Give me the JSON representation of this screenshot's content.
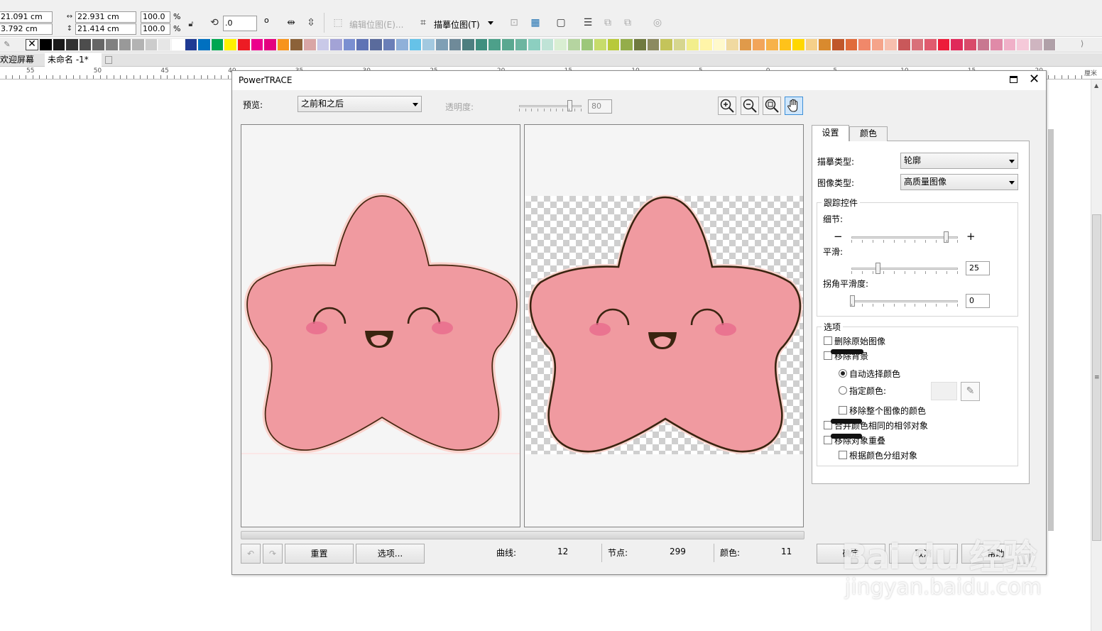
{
  "toolbar": {
    "x_value": "21.091 cm",
    "y_value": "3.792 cm",
    "width_value": "22.931 cm",
    "height_value": "21.414 cm",
    "scale_x": "100.0",
    "scale_y": "100.0",
    "percent_symbol": "%",
    "rotation_value": ".0",
    "degree_symbol": "o",
    "edit_bitmap_label": "编辑位图(E)...",
    "trace_bitmap_label": "描摹位图(T)"
  },
  "palette": {
    "colors": [
      "#000000",
      "#1a1a1a",
      "#333333",
      "#4d4d4d",
      "#666666",
      "#808080",
      "#999999",
      "#b3b3b3",
      "#cccccc",
      "#e6e6e6",
      "#ffffff",
      "#1f3a93",
      "#0070c0",
      "#00a651",
      "#fff200",
      "#ed1c24",
      "#ec008c",
      "#e4007f",
      "#f7941d",
      "#8c6239",
      "#d9a6a6",
      "#c9c9e8",
      "#a3a3d6",
      "#7a8fd1",
      "#5f73b5",
      "#5a6b9c",
      "#6a7fb8",
      "#8fb0d9",
      "#66c2e8",
      "#a3c9e0",
      "#7f9fb5",
      "#6f8a99",
      "#4d7f80",
      "#3f8f7f",
      "#4da08a",
      "#5aa890",
      "#6cb5a0",
      "#8ccfc0",
      "#bfe3d6",
      "#d9eed2",
      "#b5d4a0",
      "#9cc77a",
      "#c7dc6b",
      "#b8c93a",
      "#94ad4a",
      "#707a40",
      "#8c8a60",
      "#c4c45a",
      "#d6d68f",
      "#f2ee8c",
      "#fff5a8",
      "#fff9cc",
      "#f0d9a0",
      "#e09a4a",
      "#f2a55a",
      "#f7b24a",
      "#ffc21a",
      "#ffd700",
      "#f5d08a",
      "#d98a2e",
      "#c0572a",
      "#e06b3a",
      "#f0886a",
      "#f5a48a",
      "#f7bfae",
      "#c9585a",
      "#d9707a",
      "#e05a6e",
      "#ed1c3a",
      "#e02a5a",
      "#d94a6a",
      "#c87890",
      "#e08aa8",
      "#f0b0c8",
      "#f5c9d9",
      "#cfb5c0",
      "#b0a0a8"
    ]
  },
  "doc_tabs": {
    "welcome": "欢迎屏幕",
    "doc": "未命名 -1*"
  },
  "ruler": {
    "labels": [
      "55",
      "50",
      "45",
      "40",
      "35",
      "30",
      "25",
      "20",
      "15",
      "10",
      "5",
      "0",
      "5",
      "10",
      "15",
      "20"
    ],
    "unit": "厘米"
  },
  "dialog": {
    "title": "PowerTRACE",
    "preview_label": "预览:",
    "preview_value": "之前和之后",
    "transparency_label": "透明度:",
    "transparency_value": "80",
    "tabs": {
      "settings": "设置",
      "colors": "颜色"
    },
    "trace_type_label": "描摹类型:",
    "trace_type_value": "轮廓",
    "image_type_label": "图像类型:",
    "image_type_value": "高质量图像",
    "trace_controls_title": "跟踪控件",
    "detail_label": "细节:",
    "detail_level": 0.91,
    "smoothing_label": "平滑:",
    "smoothing_value": "25",
    "corner_label": "拐角平滑度:",
    "corner_value": "0",
    "options_title": "选项",
    "opt_delete_original": "删除原始图像",
    "opt_remove_bg": "移除背景",
    "opt_auto_color": "自动选择颜色",
    "opt_specify_color": "指定颜色:",
    "opt_remove_whole_color": "移除整个图像的颜色",
    "opt_merge_adjacent": "合并颜色相同的相邻对象",
    "opt_remove_overlap": "移除对象重叠",
    "opt_group_by_color": "根据颜色分组对象",
    "reset_button": "重置",
    "options_button": "选项...",
    "curves_label": "曲线:",
    "curves_value": "12",
    "nodes_label": "节点:",
    "nodes_value": "299",
    "colors_label": "颜色:",
    "colors_value": "11",
    "ok_button": "确定",
    "cancel_button": "取消",
    "help_button": "帮助"
  },
  "watermark": {
    "brand": "Bai du 经验",
    "url": "jingyan.baidu.com"
  }
}
